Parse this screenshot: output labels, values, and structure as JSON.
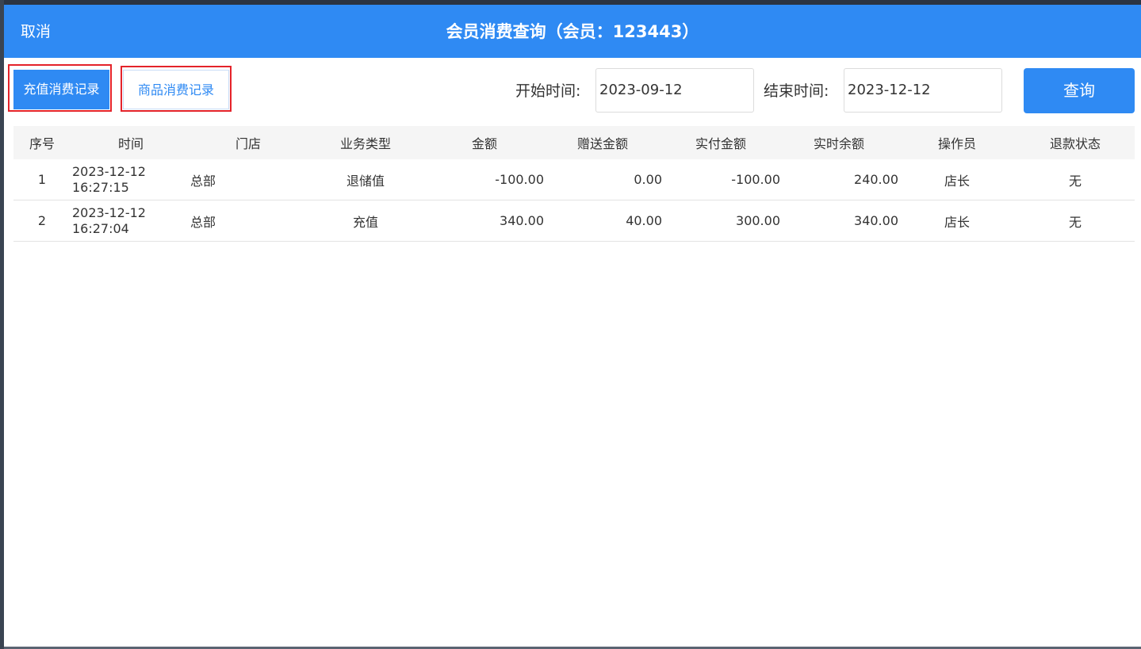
{
  "dialog": {
    "cancel_label": "取消",
    "title": "会员消费查询（会员：123443）"
  },
  "tabs": {
    "recharge": "充值消费记录",
    "goods": "商品消费记录"
  },
  "filter": {
    "start_label": "开始时间:",
    "start_value": "2023-09-12",
    "end_label": "结束时间:",
    "end_value": "2023-12-12",
    "query_label": "查询"
  },
  "table": {
    "headers": [
      "序号",
      "时间",
      "门店",
      "业务类型",
      "金额",
      "赠送金额",
      "实付金额",
      "实时余额",
      "操作员",
      "退款状态"
    ],
    "rows": [
      {
        "index": "1",
        "date": "2023-12-12",
        "time": "16:27:15",
        "store": "总部",
        "type": "退储值",
        "amount": "-100.00",
        "bonus": "0.00",
        "paid": "-100.00",
        "balance": "240.00",
        "operator": "店长",
        "refund": "无"
      },
      {
        "index": "2",
        "date": "2023-12-12",
        "time": "16:27:04",
        "store": "总部",
        "type": "充值",
        "amount": "340.00",
        "bonus": "40.00",
        "paid": "300.00",
        "balance": "340.00",
        "operator": "店长",
        "refund": "无"
      }
    ]
  },
  "colors": {
    "primary": "#2f8af3",
    "highlight_box": "#e4232a"
  }
}
